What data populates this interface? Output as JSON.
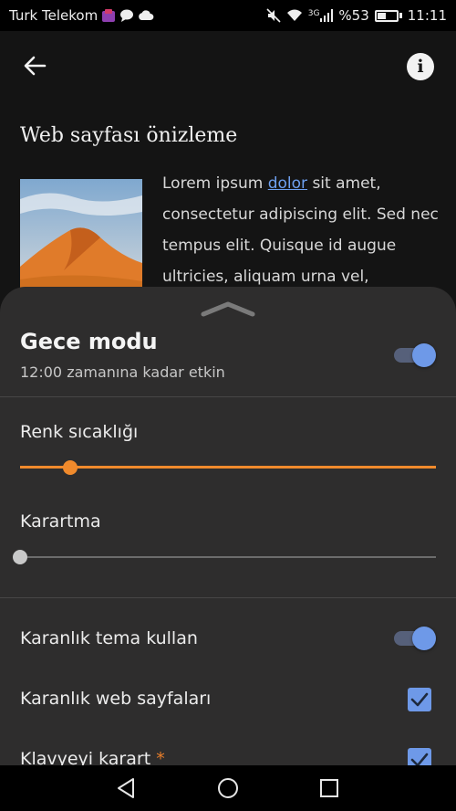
{
  "status_bar": {
    "carrier": "Turk Telekom",
    "network_type": "3G",
    "battery": "%53",
    "battery_level": 0.53,
    "time": "11:11"
  },
  "app_bar": {
    "back_icon": "back-arrow-icon",
    "info_icon": "info-icon",
    "info_glyph": "i"
  },
  "preview": {
    "title": "Web sayfası önizleme",
    "text_before_link": "Lorem ipsum ",
    "link_text": "dolor",
    "text_after_link": " sit amet, consectetur adipiscing elit. Sed nec tempus elit. Quisque id augue ultricies, aliquam urna vel,"
  },
  "night_mode": {
    "title": "Gece modu",
    "subtitle": "12:00 zamanına kadar etkin",
    "enabled": true
  },
  "color_temperature": {
    "label": "Renk sıcaklığı",
    "level": 0.12,
    "color": "#f08a2c"
  },
  "dimming": {
    "label": "Karartma",
    "level": 0.0,
    "color": "#c9c9c9"
  },
  "dark_theme": {
    "label": "Karanlık tema kullan",
    "enabled": true
  },
  "dark_web": {
    "label": "Karanlık web sayfaları",
    "checked": true
  },
  "keyboard": {
    "label": "Klavyeyi karart",
    "marker": "*",
    "checked": true
  },
  "colors": {
    "accent": "#6e99e8",
    "sheet_background": "#2e2d2d",
    "page_background": "#141414"
  }
}
